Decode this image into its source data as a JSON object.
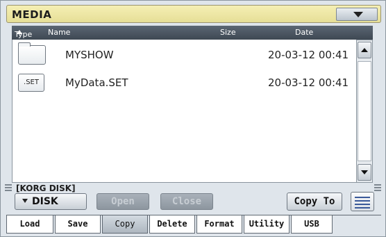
{
  "window": {
    "title": "MEDIA"
  },
  "columns": {
    "type": "Type",
    "name": "Name",
    "size": "Size",
    "date": "Date"
  },
  "files": [
    {
      "icon": "folder-icon",
      "icon_label": "",
      "name": "MYSHOW",
      "date": "20-03-12 00:41"
    },
    {
      "icon": "set-file-icon",
      "icon_label": ".SET",
      "name": "MyData.SET",
      "date": "20-03-12 00:41"
    }
  ],
  "path": "[KORG DISK]",
  "device_selector": {
    "label": "DISK"
  },
  "buttons": {
    "open": "Open",
    "close": "Close",
    "copy_to": "Copy To"
  },
  "tabs": [
    "Load",
    "Save",
    "Copy",
    "Delete",
    "Format",
    "Utility",
    "USB"
  ],
  "active_tab": "Copy",
  "colors": {
    "title_bar": "#ede69f",
    "header": "#4b5561",
    "active_tab": "#bcc4cc"
  }
}
